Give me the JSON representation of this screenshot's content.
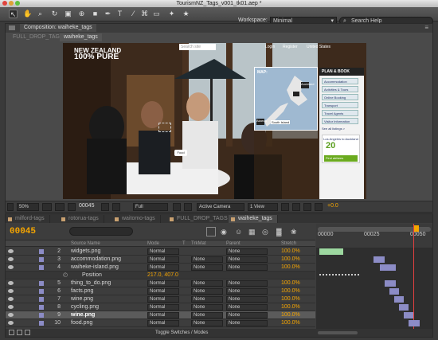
{
  "window": {
    "title": "TourismNZ_Tags_v001_tk01.aep *"
  },
  "toolbar": {
    "workspace_label": "Workspace:",
    "workspace_value": "Minimal",
    "search_placeholder": "Search Help"
  },
  "comp_panel": {
    "tab_label": "Composition: waiheke_tags",
    "subtabs": [
      "FULL_DROP_TAGS",
      "waiheke_tags"
    ],
    "viewer": {
      "logo_line1": "NEW ZEALAND",
      "logo_line2": "100% PURE",
      "search_placeholder": "Search site",
      "links": [
        "Login",
        "Register",
        "United States"
      ],
      "map_label": "MAP:",
      "map_pins": [
        "Akaroa",
        "Auckland",
        "Food",
        "South Island"
      ],
      "plan_title": "PLAN & BOOK",
      "plan_items": [
        "Accommodation",
        "Activities & Tours",
        "Online Booking",
        "Transport",
        "Travel Agents",
        "Visitor Information"
      ],
      "see_all": "See all listings >",
      "deal_title": "Los Angeles to Auckland",
      "deal_value": "20",
      "deal_cta": "Find airfares"
    },
    "status": {
      "zoom": "50%",
      "timecode": "00045",
      "resolution": "Full",
      "camera": "Active Camera",
      "views": "1 View",
      "exposure": "+0.0"
    }
  },
  "timeline": {
    "tabs": [
      {
        "label": "milford-tags",
        "color": "#c8a070"
      },
      {
        "label": "rotorua-tags",
        "color": "#c8a070"
      },
      {
        "label": "waitomo-tags",
        "color": "#c8a070"
      },
      {
        "label": "FULL_DROP_TAGS",
        "color": "#c8a070"
      },
      {
        "label": "waiheke_tags",
        "color": "#c8a070"
      }
    ],
    "timecode": "00045",
    "headers": [
      "Source Name",
      "Mode",
      "T",
      "TrkMat",
      "Parent",
      "Stretch"
    ],
    "ruler": [
      "00000",
      "00025",
      "00050"
    ],
    "layers": [
      {
        "num": "2",
        "name": "widgets.png",
        "mode": "Normal",
        "trkmat": "",
        "parent": "None",
        "stretch": "100.0%",
        "color": "#8c8cc6"
      },
      {
        "num": "3",
        "name": "accommodation.png",
        "mode": "Normal",
        "trkmat": "None",
        "parent": "None",
        "stretch": "100.0%",
        "color": "#8c8cc6"
      },
      {
        "num": "4",
        "name": "waiheke-island.png",
        "mode": "Normal",
        "trkmat": "None",
        "parent": "None",
        "stretch": "100.0%",
        "color": "#8c8cc6"
      },
      {
        "num": "",
        "name": "Position",
        "mode": "",
        "trkmat": "",
        "parent": "",
        "stretch": "",
        "value": "217.0, 407.0"
      },
      {
        "num": "5",
        "name": "thing_to_do.png",
        "mode": "Normal",
        "trkmat": "None",
        "parent": "None",
        "stretch": "100.0%",
        "color": "#8c8cc6"
      },
      {
        "num": "6",
        "name": "facts.png",
        "mode": "Normal",
        "trkmat": "None",
        "parent": "None",
        "stretch": "100.0%",
        "color": "#8c8cc6"
      },
      {
        "num": "7",
        "name": "wine.png",
        "mode": "Normal",
        "trkmat": "None",
        "parent": "None",
        "stretch": "100.0%",
        "color": "#8c8cc6"
      },
      {
        "num": "8",
        "name": "cycling.png",
        "mode": "Normal",
        "trkmat": "None",
        "parent": "None",
        "stretch": "100.0%",
        "color": "#8c8cc6"
      },
      {
        "num": "9",
        "name": "wine.png",
        "mode": "Normal",
        "trkmat": "None",
        "parent": "None",
        "stretch": "100.0%",
        "color": "#8c8cc6"
      },
      {
        "num": "10",
        "name": "food.png",
        "mode": "Normal",
        "trkmat": "None",
        "parent": "None",
        "stretch": "100.0%",
        "color": "#8c8cc6"
      }
    ],
    "bottom_label": "Toggle Switches / Modes"
  }
}
